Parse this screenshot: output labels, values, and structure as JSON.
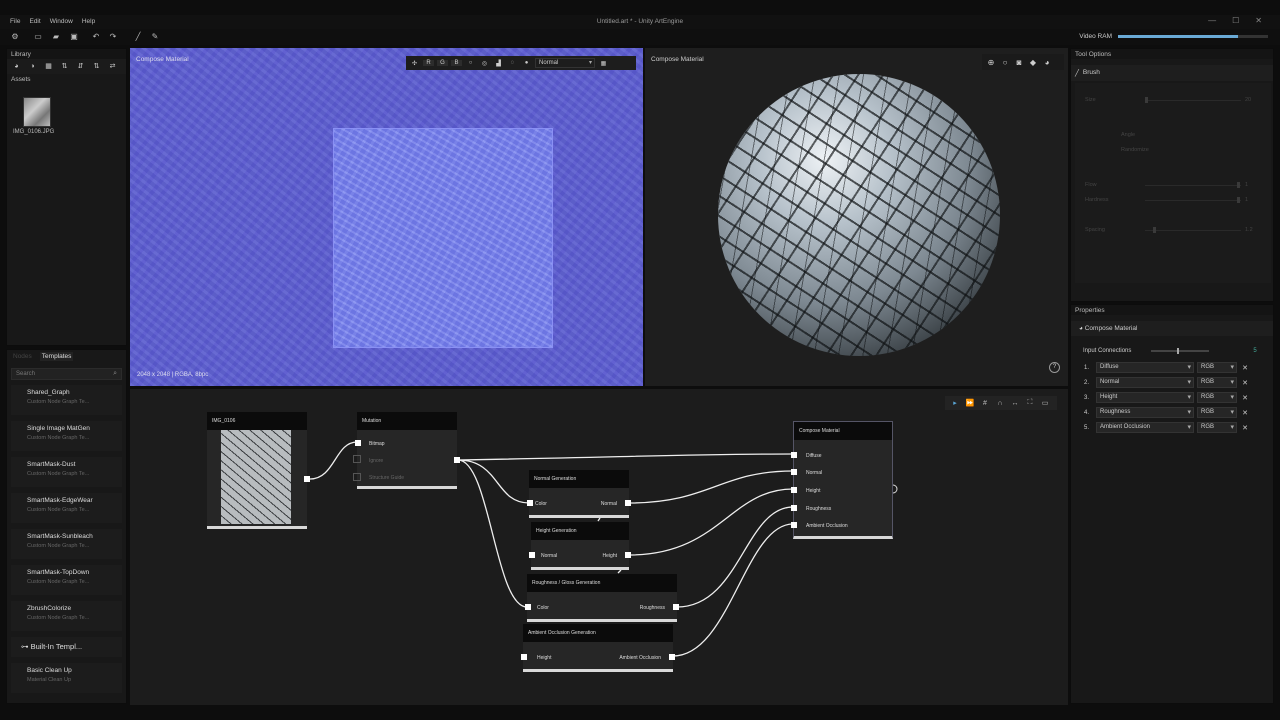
{
  "window": {
    "title": "Untitled.art * - Unity ArtEngine",
    "menu": [
      "File",
      "Edit",
      "Window",
      "Help"
    ],
    "controls": [
      "—",
      "☐",
      "✕"
    ]
  },
  "toolbar": {
    "vram_label": "Video RAM",
    "vram_fraction": 0.8
  },
  "library": {
    "title": "Library",
    "assets_label": "Assets",
    "asset_name": "IMG_0106.JPG"
  },
  "nodes_panel": {
    "tabs": [
      "Nodes",
      "Templates"
    ],
    "active_tab": "Templates",
    "search_placeholder": "Search",
    "templates": [
      {
        "title": "Shared_Graph",
        "subtitle": "Custom Node Graph Te..."
      },
      {
        "title": "Single Image MatGen",
        "subtitle": "Custom Node Graph Te..."
      },
      {
        "title": "SmartMask-Dust",
        "subtitle": "Custom Node Graph Te..."
      },
      {
        "title": "SmartMask-EdgeWear",
        "subtitle": "Custom Node Graph Te..."
      },
      {
        "title": "SmartMask-Sunbleach",
        "subtitle": "Custom Node Graph Te..."
      },
      {
        "title": "SmartMask-TopDown",
        "subtitle": "Custom Node Graph Te..."
      },
      {
        "title": "ZbrushColorize",
        "subtitle": "Custom Node Graph Te..."
      }
    ],
    "builtin_header": "Built-In Templ...",
    "builtin": [
      {
        "title": "Basic Clean Up",
        "subtitle": "Material Clean Up"
      }
    ]
  },
  "viewport2d": {
    "label": "Compose Material",
    "info": "2048 x 2048 | RGBA, 8bpc",
    "channels": [
      "R",
      "G",
      "B"
    ],
    "mode": "Normal"
  },
  "viewport3d": {
    "label": "Compose Material",
    "help": "?"
  },
  "graph": {
    "nodes": {
      "img": {
        "title": "IMG_0106"
      },
      "mutation": {
        "title": "Mutation",
        "inputs": [
          "Bitmap",
          "Ignore",
          "Structure Guide"
        ]
      },
      "normal_gen": {
        "title": "Normal Generation",
        "input": "Color",
        "output": "Normal"
      },
      "height_gen": {
        "title": "Height Generation",
        "input": "Normal",
        "output": "Height"
      },
      "rough_gen": {
        "title": "Roughness / Gloss Generation",
        "input": "Color",
        "output": "Roughness"
      },
      "ao_gen": {
        "title": "Ambient Occlusion Generation",
        "input": "Height",
        "output": "Ambient Occlusion"
      },
      "compose": {
        "title": "Compose Material",
        "inputs": [
          "Diffuse",
          "Normal",
          "Height",
          "Roughness",
          "Ambient Occlusion"
        ]
      }
    }
  },
  "tool_options": {
    "title": "Tool Options",
    "brush_label": "Brush",
    "rows": [
      "Size",
      "Angle",
      "Randomize",
      "Flow",
      "Hardness",
      "Spacing"
    ],
    "values": [
      "20",
      "1",
      "1",
      "1.2"
    ]
  },
  "properties": {
    "title": "Properties",
    "node_name": "Compose Material",
    "input_connections_label": "Input Connections",
    "input_connections_value": "5",
    "rows": [
      {
        "num": "1.",
        "name": "Diffuse",
        "fmt": "RGB"
      },
      {
        "num": "2.",
        "name": "Normal",
        "fmt": "RGB"
      },
      {
        "num": "3.",
        "name": "Height",
        "fmt": "RGB"
      },
      {
        "num": "4.",
        "name": "Roughness",
        "fmt": "RGB"
      },
      {
        "num": "5.",
        "name": "Ambient Occlusion",
        "fmt": "RGB"
      }
    ]
  }
}
